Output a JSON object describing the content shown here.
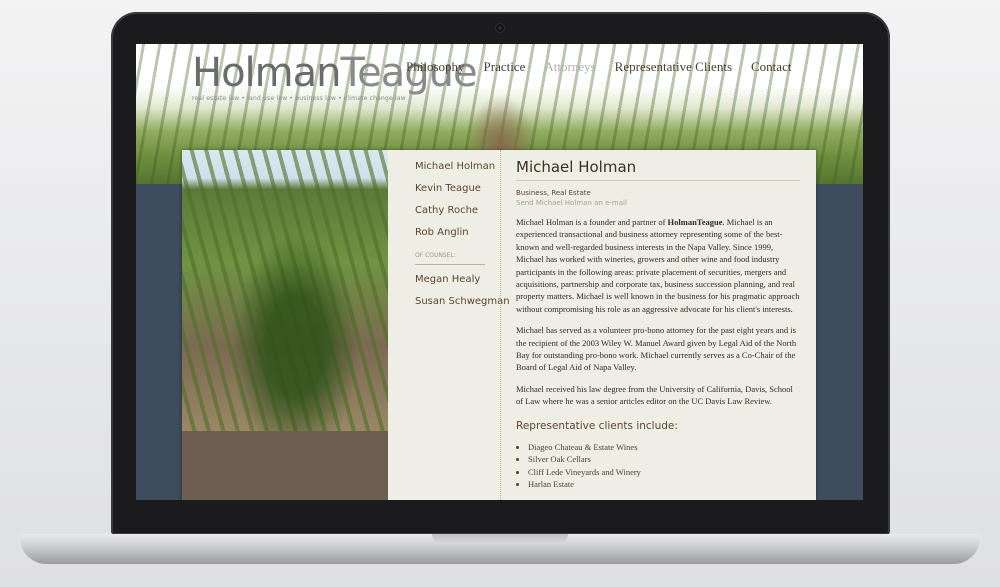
{
  "site": {
    "logo_bold": "Holman",
    "logo_light": "Teague",
    "tagline": "real estate law • land use law • business law • climate change law"
  },
  "nav": [
    {
      "label": "Philosophy"
    },
    {
      "label": "Practice"
    },
    {
      "label": "Attorneys",
      "active": true
    },
    {
      "label": "Representative Clients"
    },
    {
      "label": "Contact"
    }
  ],
  "sidebar": {
    "attorneys": [
      "Michael Holman",
      "Kevin Teague",
      "Cathy Roche",
      "Rob Anglin"
    ],
    "counsel_label": "OF COUNSEL:",
    "counsel": [
      "Megan Healy",
      "Susan Schwegman"
    ]
  },
  "profile": {
    "name": "Michael Holman",
    "role": "Business, Real Estate",
    "email_link": "Send Michael Holman an e-mail",
    "para1_a": "Michael Holman is a founder and partner of ",
    "para1_firm": "HolmanTeague",
    "para1_b": ". Michael is an experienced transactional and business attorney representing some of the best-known and well-regarded business interests in the Napa Valley. Since 1999, Michael has worked with wineries, growers and other wine and food industry participants in the following areas: private placement of securities, mergers and acquisitions, partnership and corporate tax, business succession planning, and real property matters. Michael is well known in the business for his pragmatic approach without compromising his role as an aggressive advocate for his client's interests.",
    "para2": "Michael has served as a volunteer pro-bono attorney for the past eight years and is the recipient of the 2003 Wiley W. Manuel Award given by Legal Aid of the North Bay for outstanding pro-bono work. Michael currently serves as a Co-Chair of the Board of Legal Aid of Napa Valley.",
    "para3": "Michael received his law degree from the University of California, Davis, School of Law where he was a senior articles editor on the UC Davis Law Review.",
    "clients_heading": "Representative clients include:",
    "clients": [
      "Diageo Chateau & Estate Wines",
      "Silver Oak Cellars",
      "Cliff Lede Vineyards and Winery",
      "Harlan Estate"
    ]
  }
}
